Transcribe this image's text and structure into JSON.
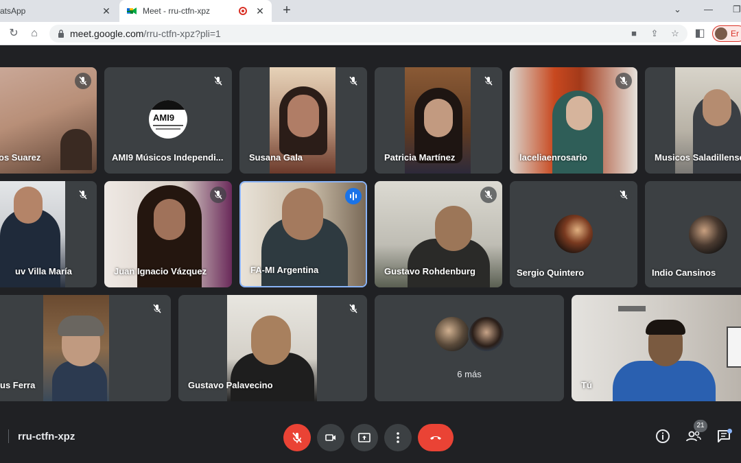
{
  "browser": {
    "tabs": [
      {
        "title": "atsApp",
        "active": false
      },
      {
        "title": "Meet - rru-ctfn-xpz",
        "active": true
      }
    ],
    "url_host": "meet.google.com",
    "url_path": "/rru-ctfn-xpz?pli=1",
    "profile_name": "Er"
  },
  "meet": {
    "meeting_code": "rru-ctfn-xpz",
    "participant_count": "21",
    "more_label": "6 más",
    "participants": [
      {
        "name": "os Suarez",
        "muted": true
      },
      {
        "name": "AMI9 Músicos Independi...",
        "muted": true
      },
      {
        "name": "Susana Gala",
        "muted": true
      },
      {
        "name": "Patricia Martínez",
        "muted": true
      },
      {
        "name": "laceliaenrosario",
        "muted": true
      },
      {
        "name": "Musicos Saladillense",
        "muted": false
      },
      {
        "name": "uv Villa María",
        "muted": true
      },
      {
        "name": "Juan Ignacio Vázquez",
        "muted": true
      },
      {
        "name": "FA-MI Argentina",
        "muted": false,
        "speaking": true
      },
      {
        "name": "Gustavo Rohdenburg",
        "muted": true
      },
      {
        "name": "Sergio Quintero",
        "muted": true
      },
      {
        "name": "Indio Cansinos",
        "muted": false
      },
      {
        "name": "us Ferra",
        "muted": true
      },
      {
        "name": "Gustavo Palavecino",
        "muted": true
      },
      {
        "name": "Tú",
        "muted": false
      }
    ],
    "logo_text": "AMI9"
  },
  "colors": {
    "background": "#202124",
    "tile": "#3c4043",
    "accent": "#8ab4f8",
    "danger": "#ea4335"
  }
}
